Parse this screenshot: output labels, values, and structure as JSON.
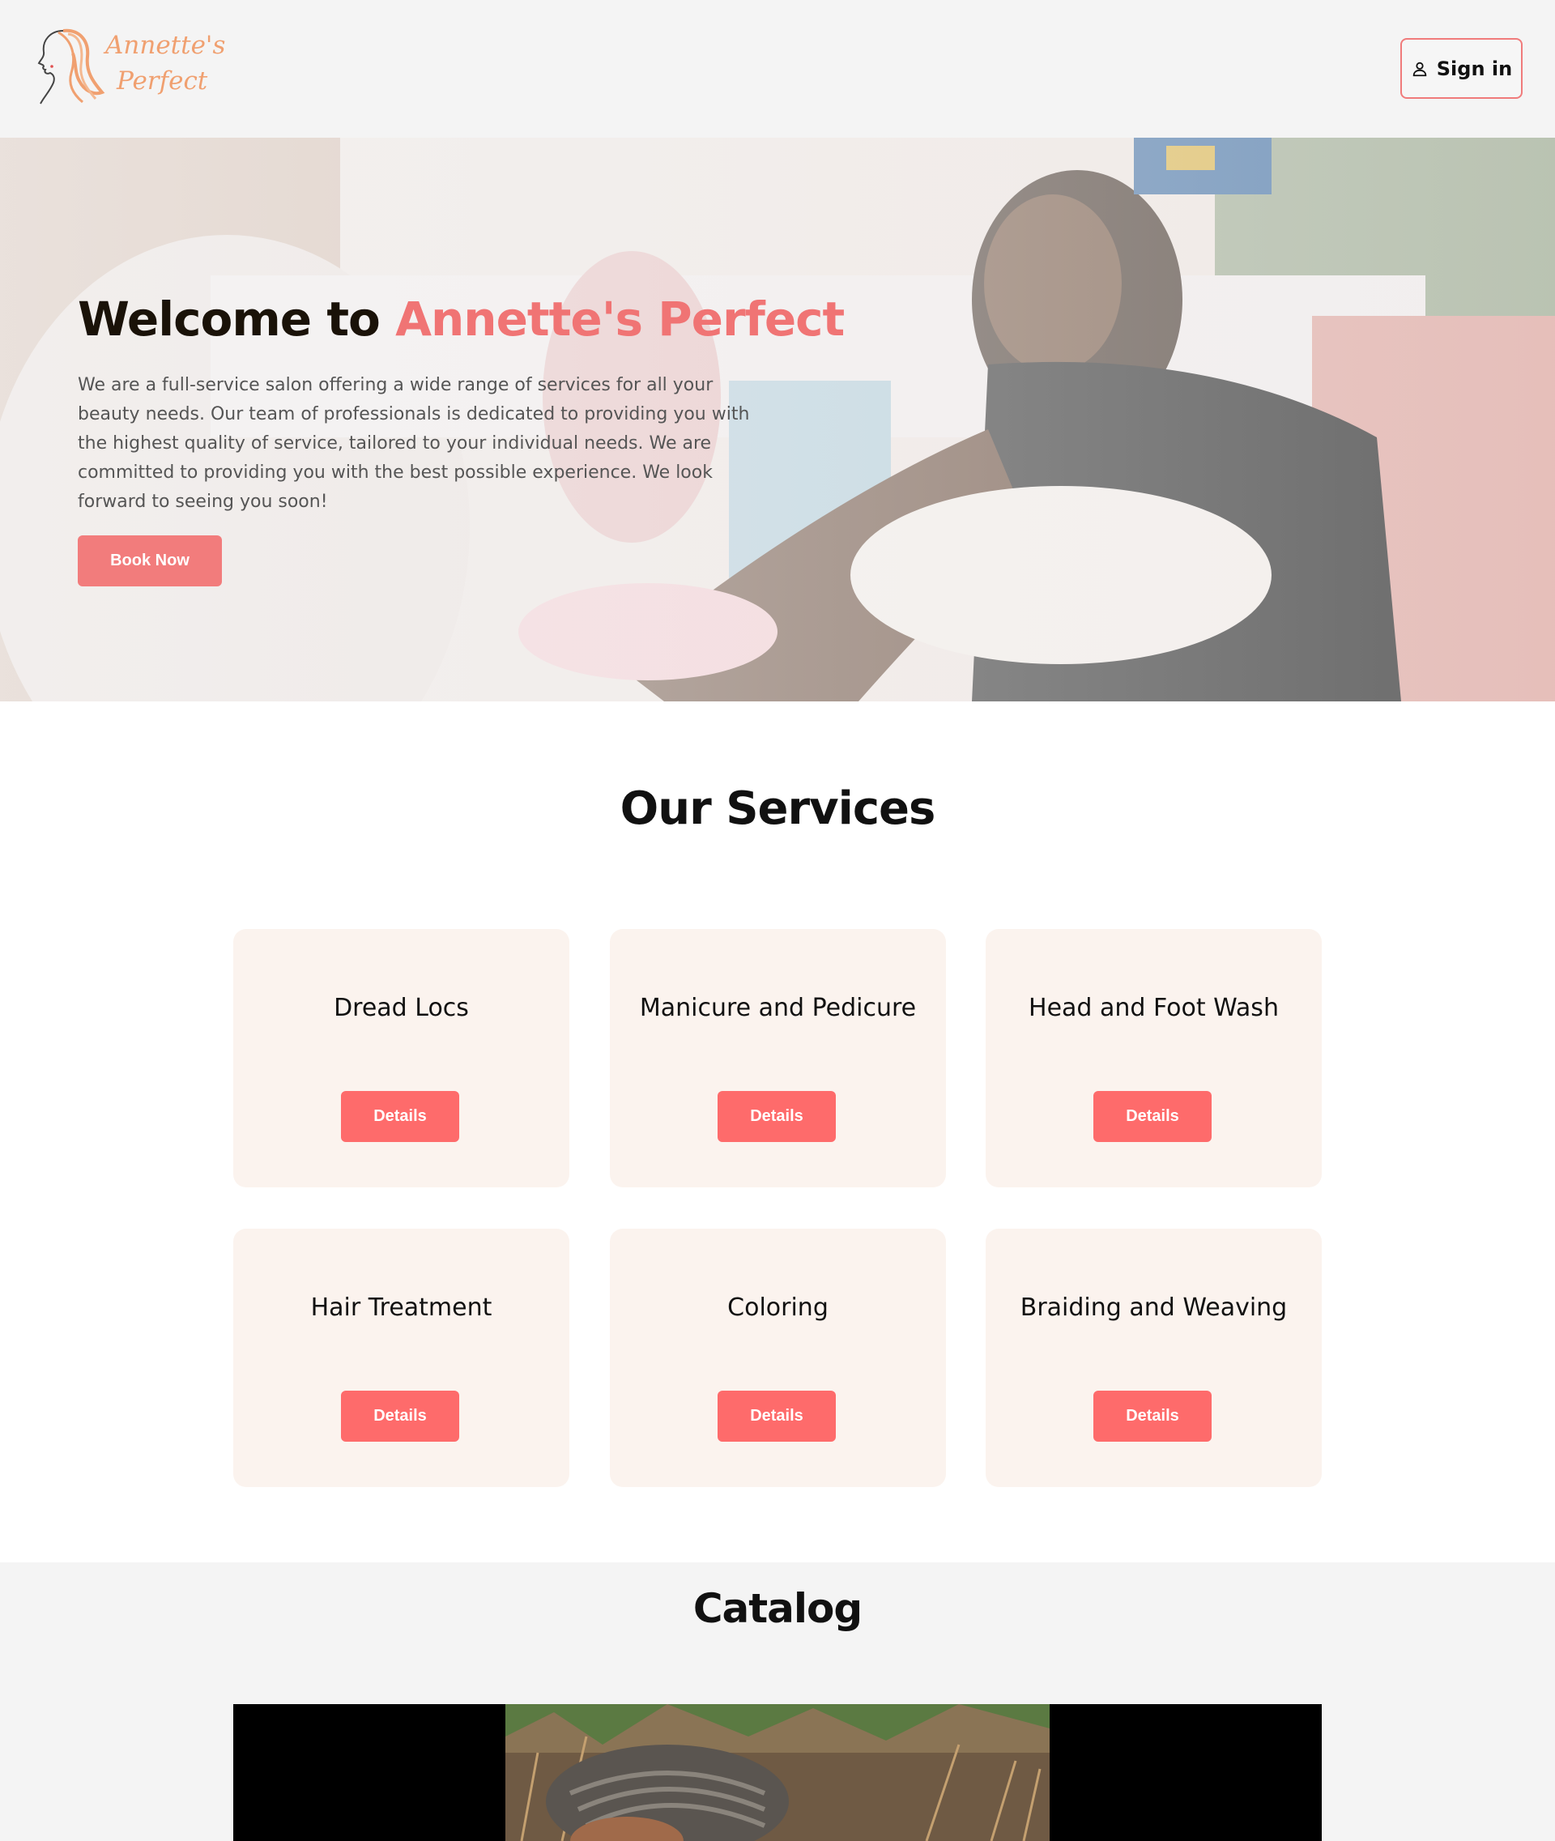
{
  "brand": {
    "line1": "Annette's",
    "line2": "Perfect"
  },
  "header": {
    "signin_label": "Sign in"
  },
  "hero": {
    "title_prefix": "Welcome to ",
    "title_accent": "Annette's Perfect",
    "description": "We are a full-service salon offering a wide range of services for all your beauty needs. Our team of professionals is dedicated to providing you with the highest quality of service, tailored to your individual needs. We are committed to providing you with the best possible experience. We look forward to seeing you soon!",
    "cta_label": "Book Now"
  },
  "services": {
    "title": "Our Services",
    "items": [
      {
        "name": "Dread Locs",
        "button": "Details"
      },
      {
        "name": "Manicure and Pedicure",
        "button": "Details"
      },
      {
        "name": "Head and Foot Wash",
        "button": "Details"
      },
      {
        "name": "Hair Treatment",
        "button": "Details"
      },
      {
        "name": "Coloring",
        "button": "Details"
      },
      {
        "name": "Braiding and Weaving",
        "button": "Details"
      }
    ]
  },
  "catalog": {
    "title": "Catalog"
  },
  "colors": {
    "accent": "#f07474",
    "button": "#fe6b6b",
    "card_bg": "#fbf3ee",
    "logo": "#f0a070"
  }
}
